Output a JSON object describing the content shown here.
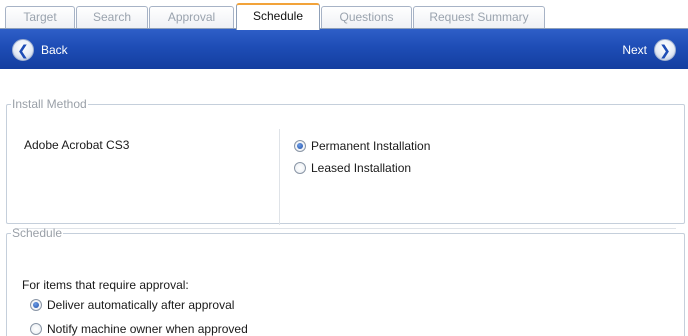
{
  "tabs": [
    {
      "label": "Target",
      "active": false
    },
    {
      "label": "Search",
      "active": false
    },
    {
      "label": "Approval",
      "active": false
    },
    {
      "label": "Schedule",
      "active": true
    },
    {
      "label": "Questions",
      "active": false
    },
    {
      "label": "Request Summary",
      "active": false
    }
  ],
  "nav": {
    "back_label": "Back",
    "next_label": "Next",
    "back_icon": "arrow-left-circle-icon",
    "next_icon": "arrow-right-circle-icon"
  },
  "install_method": {
    "legend": "Install Method",
    "application": "Adobe Acrobat CS3",
    "options": [
      {
        "label": "Permanent Installation",
        "checked": true
      },
      {
        "label": "Leased Installation",
        "checked": false
      }
    ]
  },
  "schedule": {
    "legend": "Schedule",
    "prompt": "For items that require approval:",
    "options": [
      {
        "label": "Deliver automatically after approval",
        "checked": true
      },
      {
        "label": "Notify machine owner when approved",
        "checked": false
      }
    ]
  },
  "colors": {
    "nav_bar": "#1e4db6",
    "active_tab_accent": "#f2a33a",
    "border": "#c5cfdb"
  }
}
